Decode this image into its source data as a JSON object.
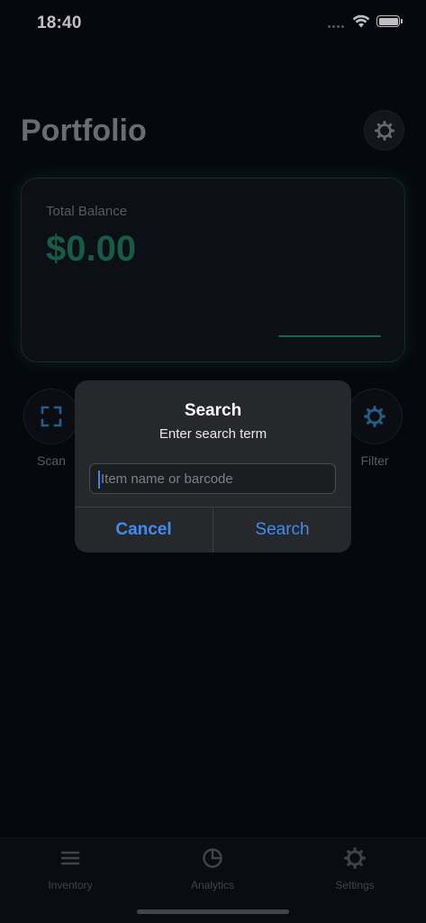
{
  "status_bar": {
    "time": "18:40"
  },
  "header": {
    "title": "Portfolio",
    "settings_icon": "gear-icon"
  },
  "balance_card": {
    "label": "Total Balance",
    "value": "$0.00",
    "value_color": "#1f7a5c"
  },
  "actions": [
    {
      "label": "Scan",
      "icon": "scan-frame-icon"
    },
    {
      "label": "Filter",
      "icon": "gear-icon"
    }
  ],
  "alert": {
    "title": "Search",
    "message": "Enter search term",
    "input_placeholder": "Item name or barcode",
    "input_value": "",
    "cancel_label": "Cancel",
    "confirm_label": "Search"
  },
  "tab_bar": {
    "items": [
      {
        "label": "Inventory",
        "icon": "list-icon"
      },
      {
        "label": "Analytics",
        "icon": "pie-chart-icon"
      },
      {
        "label": "Settings",
        "icon": "gear-icon"
      }
    ]
  },
  "colors": {
    "accent": "#3d8df5",
    "background": "#080b13",
    "card_border": "#1d3a36"
  }
}
